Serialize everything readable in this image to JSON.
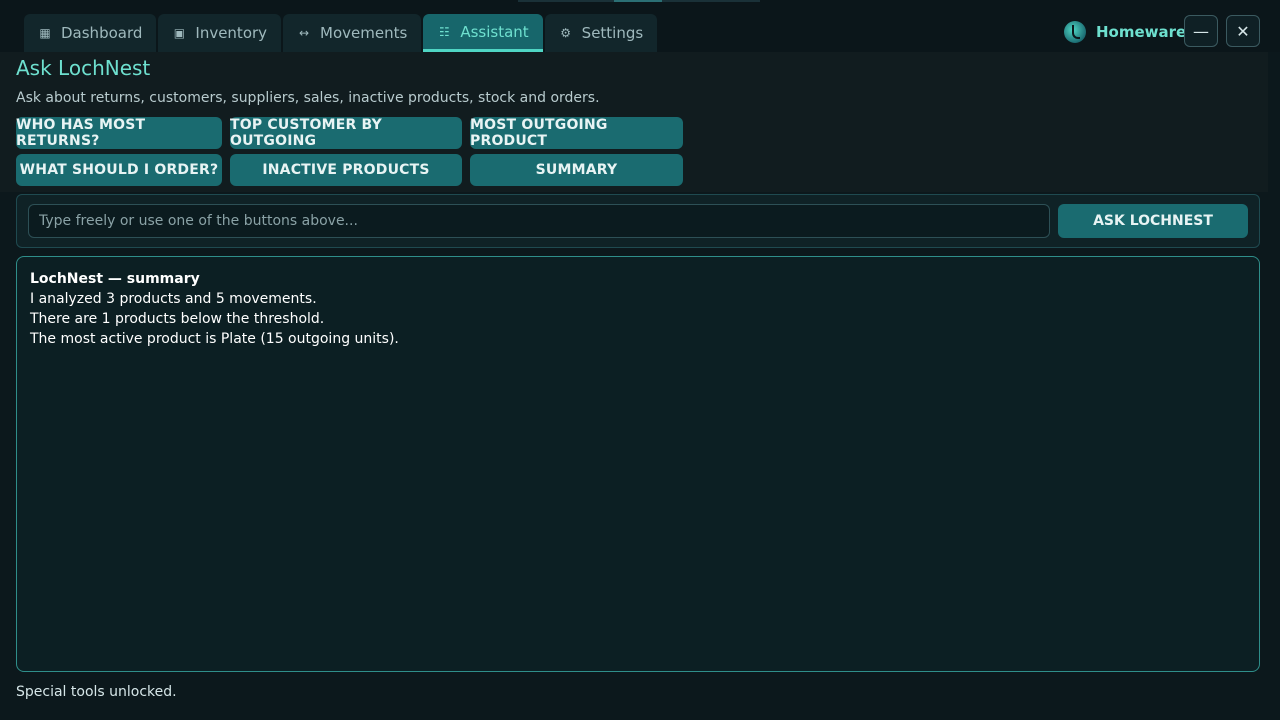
{
  "nav": {
    "tabs": [
      {
        "label": "Dashboard",
        "icon": "grid-icon",
        "active": false
      },
      {
        "label": "Inventory",
        "icon": "box-icon",
        "active": false
      },
      {
        "label": "Movements",
        "icon": "arrows-icon",
        "active": false
      },
      {
        "label": "Assistant",
        "icon": "list-icon",
        "active": true
      },
      {
        "label": "Settings",
        "icon": "gear-icon",
        "active": false
      }
    ]
  },
  "brand": {
    "name": "Homeware",
    "logo": "lochnest-logo"
  },
  "window": {
    "minimize": "—",
    "close": "✕"
  },
  "page": {
    "title": "Ask LochNest",
    "subtitle": "Ask about returns, customers, suppliers, sales, inactive products, stock and orders."
  },
  "quick_questions": [
    "WHO HAS MOST RETURNS?",
    "TOP CUSTOMER BY OUTGOING",
    "MOST OUTGOING PRODUCT",
    "WHAT SHOULD I ORDER?",
    "INACTIVE PRODUCTS",
    "SUMMARY"
  ],
  "ask": {
    "value": "",
    "placeholder": "Type freely or use one of the buttons above...",
    "button_label": "ASK LOCHNEST"
  },
  "answer": {
    "heading": "LochNest — summary",
    "lines": [
      "I analyzed 3 products and 5 movements.",
      "There are 1 products below the threshold.",
      "The most active product is Plate (15 outgoing units)."
    ]
  },
  "status": "Special tools unlocked.",
  "colors": {
    "accent": "#4fd6c4",
    "button": "#1a6b70",
    "background": "#0c181c"
  }
}
